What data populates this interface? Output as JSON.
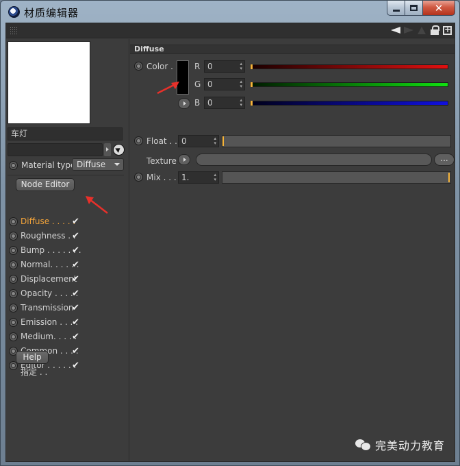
{
  "window": {
    "title": "材质编辑器",
    "close_glyph": "✕"
  },
  "toolbar": {
    "icons": [
      "arrow-left-icon",
      "arrow-right-icon",
      "up-icon",
      "lock-icon",
      "new-window-icon"
    ]
  },
  "left_panel": {
    "material_name": "车灯",
    "material_type_label": "Material type",
    "material_type_value": "Diffuse",
    "node_editor_label": "Node Editor",
    "help_label": "Help",
    "assign_label": "指定 . .",
    "check_mark": "✔",
    "channels": [
      {
        "label": "Diffuse . . . . .",
        "active": true,
        "enabled": true
      },
      {
        "label": "Roughness . .",
        "active": false,
        "enabled": true
      },
      {
        "label": "Bump . . . . . . .",
        "active": false,
        "enabled": true
      },
      {
        "label": "Normal. . . . . .",
        "active": false,
        "enabled": true
      },
      {
        "label": "Displacement",
        "active": false,
        "enabled": true
      },
      {
        "label": "Opacity . . . . .",
        "active": false,
        "enabled": true
      },
      {
        "label": "Transmission",
        "active": false,
        "enabled": true
      },
      {
        "label": "Emission . . . .",
        "active": false,
        "enabled": true
      },
      {
        "label": "Medium. . . . .",
        "active": false,
        "enabled": true
      },
      {
        "label": "Common . . . .",
        "active": false,
        "enabled": true
      },
      {
        "label": "Editor . . . . . .",
        "active": false,
        "enabled": true
      }
    ]
  },
  "diffuse": {
    "section_title": "Diffuse",
    "color_label": "Color .",
    "r_label": "R",
    "g_label": "G",
    "b_label": "B",
    "r_value": "0",
    "g_value": "0",
    "b_value": "0",
    "float_label": "Float . .",
    "float_value": "0",
    "texture_label": "Texture",
    "texture_button": "...",
    "mix_label": "Mix . . .",
    "mix_value": "1.",
    "mix_fraction": 1.0,
    "float_fraction": 0.0
  },
  "colors": {
    "active_channel": "#f2a33a",
    "annotation_arrow": "#e8302a",
    "slider_knob": "#f6b43a"
  },
  "watermark": {
    "text": "完美动力教育"
  }
}
